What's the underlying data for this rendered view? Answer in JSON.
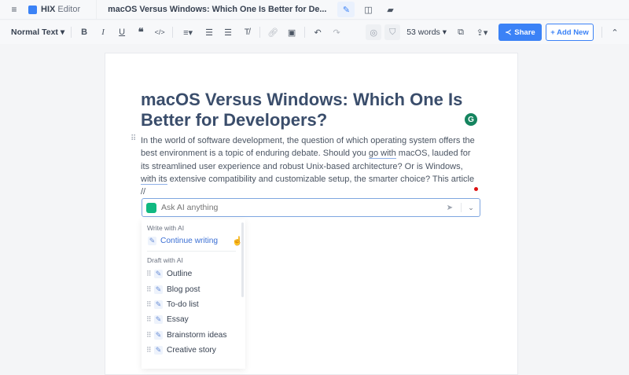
{
  "topbar": {
    "app_name_bold": "HIX",
    "app_name": " Editor",
    "doc_title": "macOS Versus Windows: Which One Is Better for De..."
  },
  "toolbar": {
    "text_style": "Normal Text",
    "word_count": "53 words",
    "share_label": "Share",
    "add_new_label": "+ Add New"
  },
  "document": {
    "title": "macOS Versus Windows: Which One Is Better for Developers?",
    "p1": "In the world of software development, the question of which operating system offers the best environment is a topic of enduring debate. Should you ",
    "p_u1": "go with",
    "p2": " macOS, lauded for its streamlined user experience and robust Unix-based architecture? Or is Windows,",
    "p_u2": "with its",
    "p3": " extensive compatibility and customizable setup,",
    "p4": " the smarter choice? This article",
    "p5": "//"
  },
  "ai": {
    "placeholder": "Ask AI anything",
    "write_header": "Write with AI",
    "continue": "Continue writing",
    "draft_header": "Draft with AI",
    "items": [
      "Outline",
      "Blog post",
      "To-do list",
      "Essay",
      "Brainstorm ideas",
      "Creative story"
    ]
  },
  "colors": {
    "accent": "#3b82f6",
    "title": "#3a4d6b"
  }
}
